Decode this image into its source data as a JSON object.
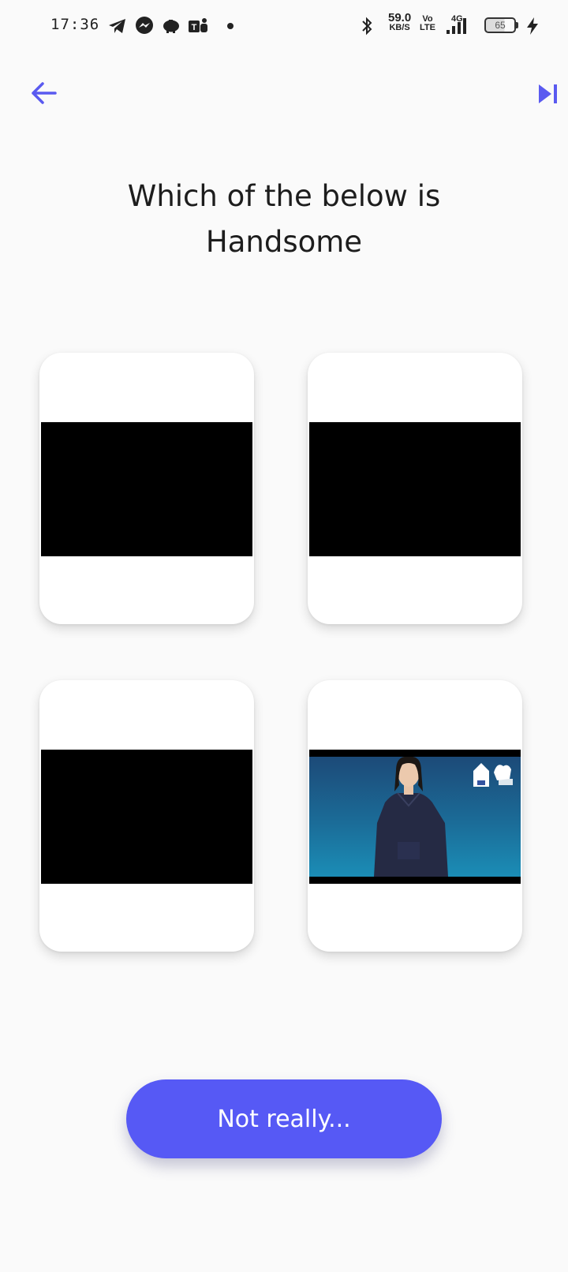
{
  "status_bar": {
    "time": "17:36",
    "net_speed_value": "59.0",
    "net_speed_unit": "KB/S",
    "volte_top": "Vo",
    "volte_bottom": "LTE",
    "network_type": "4G",
    "battery_level": "65",
    "icons": [
      "telegram-icon",
      "messenger-icon",
      "piggy-bank-icon",
      "teams-icon",
      "bluetooth-icon",
      "signal-icon",
      "charging-icon"
    ]
  },
  "nav": {
    "back_icon": "arrow-left-icon",
    "skip_icon": "skip-next-icon",
    "accent": "#5a5af0"
  },
  "question": {
    "title": "Which of the below is Handsome"
  },
  "options": [
    {
      "media": "black-video"
    },
    {
      "media": "black-video"
    },
    {
      "media": "black-video"
    },
    {
      "media": "video-sign-language-presenter"
    }
  ],
  "cta": {
    "label": "Not really...",
    "color": "#5659f5"
  }
}
